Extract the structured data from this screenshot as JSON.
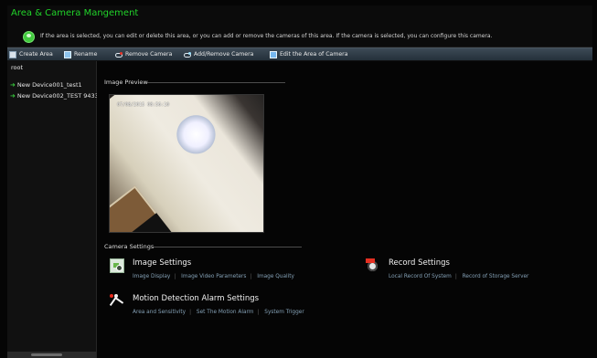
{
  "app": {
    "title": "Area & Camera Mangement",
    "info_text": "If the area is selected, you can edit or delete this area, or you can add or remove the cameras of this area. If the camera is selected, you can configure this camera."
  },
  "toolbar": {
    "create_area": "Create Area",
    "rename": "Rename",
    "remove_camera": "Remove Camera",
    "add_remove_camera": "Add/Remove Camera",
    "edit_area": "Edit the Area of Camera"
  },
  "tree": {
    "root": "root",
    "items": [
      {
        "label": "New Device001_test1"
      },
      {
        "label": "New Device002_TEST 9433"
      }
    ]
  },
  "preview": {
    "label": "Image Preview",
    "timestamp": "07/08/2015 08:56:10"
  },
  "camera_settings": {
    "label": "Camera Settings",
    "image": {
      "title": "Image Settings",
      "links": [
        "Image Display",
        "Image Video Parameters",
        "Image Quality"
      ]
    },
    "record": {
      "title": "Record Settings",
      "links": [
        "Local Record Of System",
        "Record of Storage Server"
      ]
    },
    "motion": {
      "title": "Motion Detection Alarm Settings",
      "links": [
        "Area and Sensitivity",
        "Set The Motion Alarm",
        "System Trigger"
      ]
    }
  },
  "icons": {
    "info": "info-icon",
    "create_area": "create-area-icon",
    "rename": "rename-icon",
    "remove_camera": "remove-camera-icon",
    "add_remove_camera": "add-remove-camera-icon",
    "edit_area": "edit-area-icon",
    "device": "device-icon",
    "image_settings": "image-settings-icon",
    "record_settings": "record-settings-icon",
    "motion_settings": "motion-detection-icon"
  },
  "colors": {
    "title_green": "#21d42a",
    "link_blue": "#84a0b5",
    "background": "#050505"
  }
}
